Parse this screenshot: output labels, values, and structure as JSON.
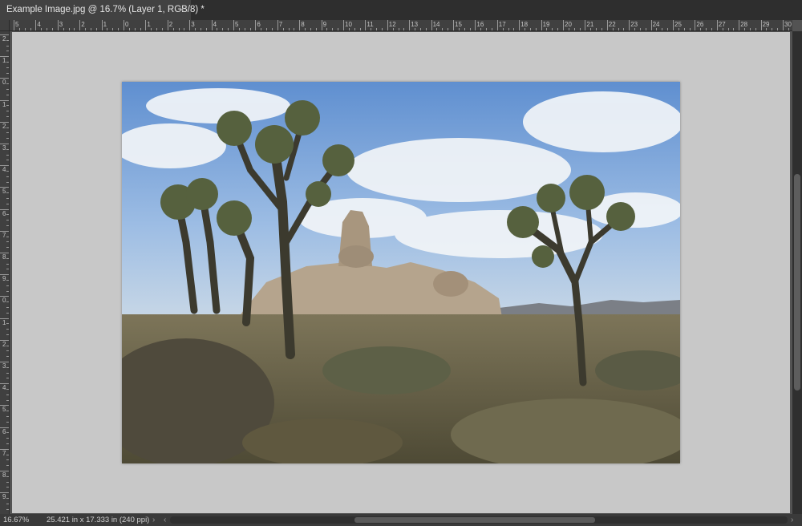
{
  "document_tab": {
    "title": "Example Image.jpg @ 16.7% (Layer 1, RGB/8) *",
    "close_glyph": "×"
  },
  "rulers": {
    "horizontal_labels": [
      "5",
      "4",
      "3",
      "2",
      "1",
      "0",
      "1",
      "2",
      "3",
      "4",
      "5",
      "6",
      "7",
      "8",
      "9",
      "10",
      "11",
      "12",
      "13",
      "14",
      "15",
      "16",
      "17",
      "18",
      "19",
      "20",
      "21",
      "22",
      "23",
      "24",
      "25",
      "26",
      "27",
      "28",
      "29",
      "30"
    ],
    "vertical_labels": [
      "2",
      "1",
      "0",
      "1",
      "2",
      "3",
      "4",
      "5",
      "6",
      "7",
      "8",
      "9",
      "0",
      "1",
      "2",
      "3",
      "4",
      "5",
      "6",
      "7",
      "8",
      "9"
    ]
  },
  "status": {
    "zoom": "16.67%",
    "document_size": "25.421 in x 17.333 in (240 ppi)",
    "expand_glyph": "›",
    "scroll_left_glyph": "‹",
    "scroll_right_glyph": "›"
  },
  "image": {
    "description_name": "joshua-tree-landscape",
    "sky_color": "#7ea6d6",
    "ground_color": "#6a6446"
  },
  "colors": {
    "pasteboard": "#c8c8c8",
    "workspace": "#535353",
    "tab_active": "#424242"
  }
}
